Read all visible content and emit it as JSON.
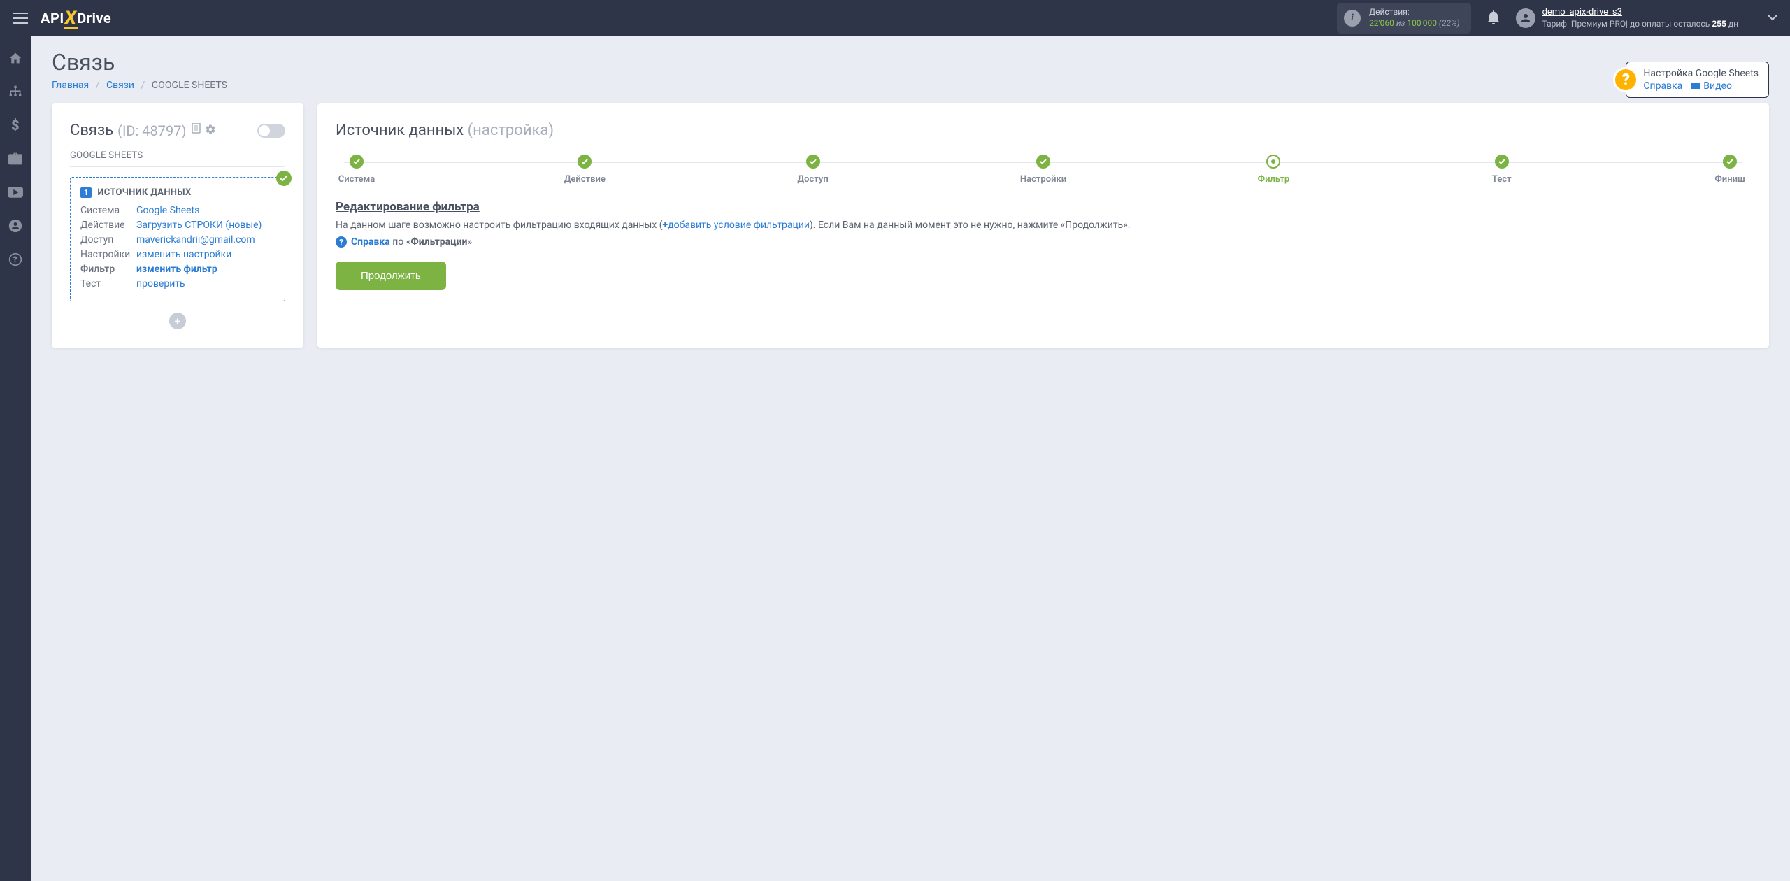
{
  "header": {
    "logo_pre": "API",
    "logo_x": "X",
    "logo_post": "Drive",
    "actions_label": "Действия:",
    "actions_used": "22'060",
    "actions_of": " из ",
    "actions_total": "100'000",
    "actions_pct": " (22%)",
    "user_name": "demo_apix-drive_s3",
    "tariff_pre": "Тариф |Премиум PRO| до оплаты осталось ",
    "tariff_days": "255",
    "tariff_suf": " дн"
  },
  "page": {
    "title": "Связь",
    "bc_home": "Главная",
    "bc_links": "Связи",
    "bc_current": "GOOGLE SHEETS"
  },
  "help": {
    "title": "Настройка Google Sheets",
    "ref": "Справка",
    "video": "Видео"
  },
  "left": {
    "title": "Связь",
    "id": "(ID: 48797)",
    "name": "GOOGLE SHEETS",
    "source_title": "ИСТОЧНИК ДАННЫХ",
    "badge": "1",
    "rows": {
      "system_l": "Система",
      "system_v": "Google Sheets",
      "action_l": "Действие",
      "action_v": "Загрузить СТРОКИ (новые)",
      "access_l": "Доступ",
      "access_v": "maverickandrii@gmail.com",
      "settings_l": "Настройки",
      "settings_v": "изменить настройки",
      "filter_l": "Фильтр",
      "filter_v": "изменить фильтр",
      "test_l": "Тест",
      "test_v": "проверить"
    }
  },
  "right": {
    "title": "Источник данных ",
    "title_muted": "(настройка)",
    "steps": [
      "Система",
      "Действие",
      "Доступ",
      "Настройки",
      "Фильтр",
      "Тест",
      "Финиш"
    ],
    "filter_heading": "Редактирование фильтра",
    "desc_pre": "На данном шаге возможно настроить фильтрацию входящих данных (",
    "desc_plus": "+",
    "desc_link": "добавить условие фильтрации",
    "desc_post": "). Если Вам на данный момент это не нужно, нажмите «Продолжить».",
    "help_ref": "Справка",
    "help_txt": " по «",
    "help_bold": "Фильтрации",
    "help_end": "»",
    "continue": "Продолжить"
  }
}
